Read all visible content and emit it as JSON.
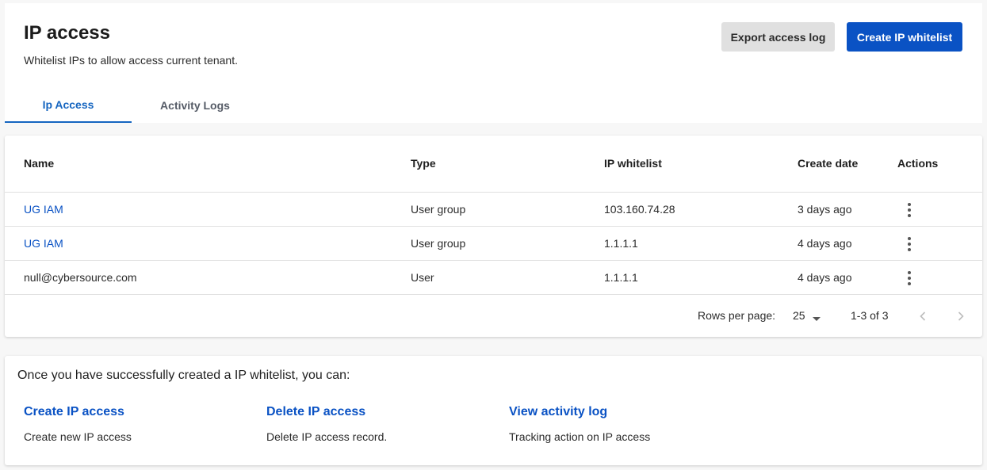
{
  "header": {
    "title": "IP access",
    "subtitle": "Whitelist IPs to allow access current tenant.",
    "export_label": "Export access log",
    "create_label": "Create IP whitelist"
  },
  "tabs": [
    {
      "label": "Ip Access",
      "active": true
    },
    {
      "label": "Activity Logs",
      "active": false
    }
  ],
  "table": {
    "columns": [
      "Name",
      "Type",
      "IP whitelist",
      "Create date",
      "Actions"
    ],
    "rows": [
      {
        "name": "UG IAM",
        "type": "User group",
        "ip": "103.160.74.28",
        "date": "3 days ago"
      },
      {
        "name": "UG IAM",
        "type": "User group",
        "ip": "1.1.1.1",
        "date": "4 days ago"
      },
      {
        "name": "null@cybersource.com",
        "type": "User",
        "ip": "1.1.1.1",
        "date": "4 days ago"
      }
    ]
  },
  "pagination": {
    "rows_per_page_label": "Rows per page:",
    "rows_per_page": "25",
    "range": "1-3 of 3"
  },
  "info": {
    "heading": "Once you have successfully created a IP whitelist, you can:",
    "items": [
      {
        "title": "Create IP access",
        "desc": "Create new IP access"
      },
      {
        "title": "Delete IP access",
        "desc": "Delete IP access record."
      },
      {
        "title": "View activity log",
        "desc": "Tracking action on IP access"
      }
    ]
  },
  "colors": {
    "accent": "#0a52c4",
    "tab_active": "#1565c0",
    "secondary_button": "#e0e0e0",
    "background": "#f7f7f7"
  },
  "icons": {
    "row_actions": "more-vertical-icon",
    "select_caret": "caret-down-icon",
    "prev_page": "chevron-left-icon",
    "next_page": "chevron-right-icon"
  }
}
